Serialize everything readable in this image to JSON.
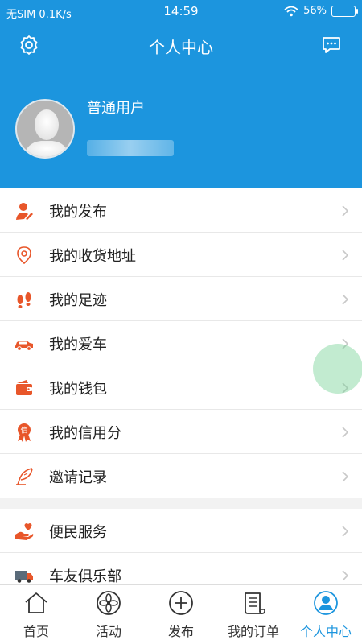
{
  "status_bar": {
    "carrier": "无SIM 0.1K/s",
    "time": "14:59",
    "battery": "56%",
    "battery_level": 0.56
  },
  "header": {
    "title": "个人中心"
  },
  "profile": {
    "username": "普通用户"
  },
  "menu_group_1": [
    {
      "label": "我的发布",
      "icon": "user-edit-icon"
    },
    {
      "label": "我的收货地址",
      "icon": "location-pin-icon"
    },
    {
      "label": "我的足迹",
      "icon": "footprints-icon"
    },
    {
      "label": "我的爱车",
      "icon": "car-icon"
    },
    {
      "label": "我的钱包",
      "icon": "wallet-icon"
    },
    {
      "label": "我的信用分",
      "icon": "credit-badge-icon"
    },
    {
      "label": "邀请记录",
      "icon": "quill-icon"
    }
  ],
  "menu_group_2": [
    {
      "label": "便民服务",
      "icon": "hand-heart-icon"
    },
    {
      "label": "车友俱乐部",
      "icon": "truck-icon"
    }
  ],
  "tabs": [
    {
      "label": "首页",
      "icon": "home-icon",
      "active": false
    },
    {
      "label": "活动",
      "icon": "activity-flower-icon",
      "active": false
    },
    {
      "label": "发布",
      "icon": "plus-circle-icon",
      "active": false
    },
    {
      "label": "我的订单",
      "icon": "order-receipt-icon",
      "active": false
    },
    {
      "label": "个人中心",
      "icon": "person-circle-icon",
      "active": true
    }
  ],
  "colors": {
    "primary": "#1c95de",
    "accent_orange": "#e8562a"
  },
  "credit_badge_char": "信"
}
